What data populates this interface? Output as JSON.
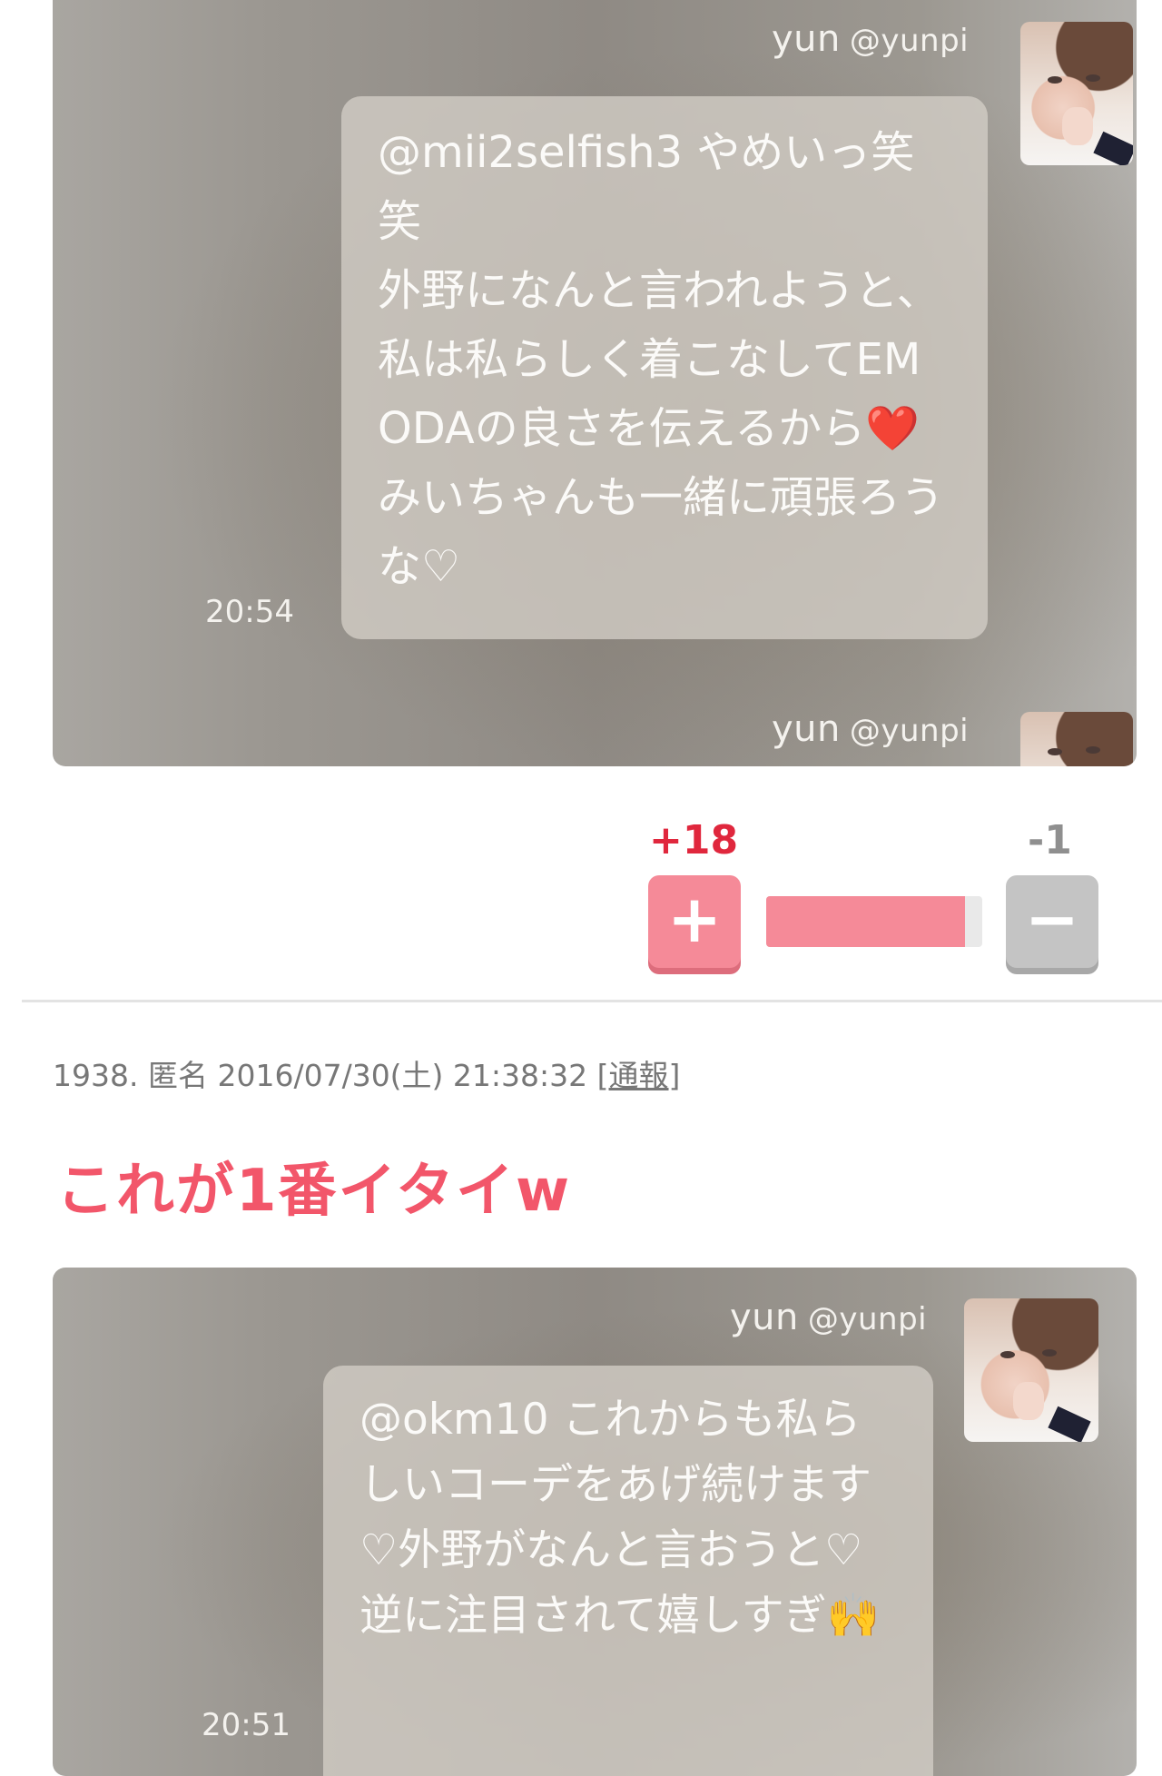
{
  "screenshots": [
    {
      "user_name": "yun",
      "user_handle": "@yunpi",
      "message": "@mii2selfish3 やめいっ笑笑\n外野になんと言われようと、私は私らしく着こなしてEMODAの良さを伝えるから❤️みいちゃんも一緒に頑張ろうな♡",
      "time": "20:54",
      "next_user_name": "yun",
      "next_user_handle": "@yunpi"
    },
    {
      "user_name": "yun",
      "user_handle": "@yunpi",
      "message": "@okm10 これからも私らしいコーデをあげ続けます♡外野がなんと言おうと♡逆に注目されて嬉しすぎ🙌",
      "time": "20:51"
    }
  ],
  "vote": {
    "plus_count": "+18",
    "minus_count": "-1",
    "plus_label": "+",
    "minus_label": "−",
    "plus_ratio": 0.92
  },
  "comment": {
    "number": "1938.",
    "author": "匿名",
    "datetime": "2016/07/30(土) 21:38:32",
    "report_label": "通報",
    "body": "これが1番イタイw"
  },
  "colors": {
    "accent_pink": "#f2566a",
    "plus_red": "#e0273d",
    "plus_button": "#f58a98",
    "minus_button": "#c4c4c4"
  }
}
